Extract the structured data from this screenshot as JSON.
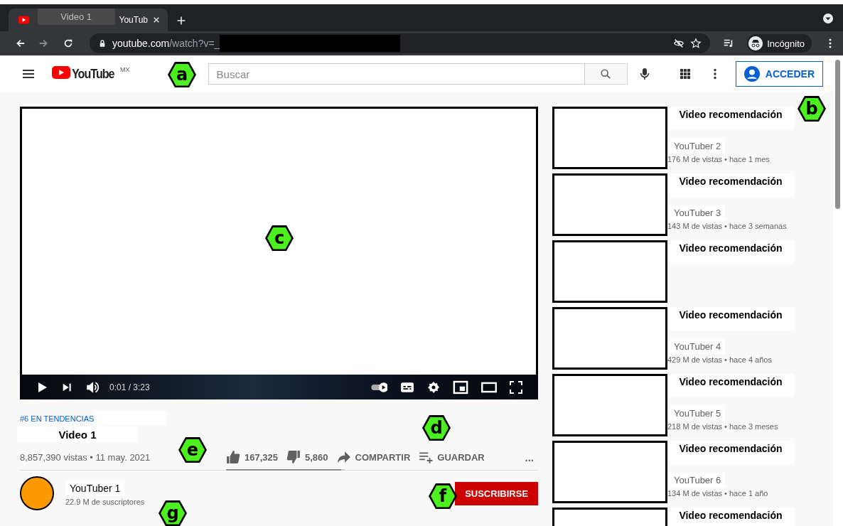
{
  "browser": {
    "tabs": [
      {
        "title_overlay": "Video 1",
        "title": "YouTub",
        "selected": true
      }
    ],
    "address": {
      "host": "youtube.com",
      "path": "/watch?v=_"
    },
    "profile": "Incógnito"
  },
  "header": {
    "logo": "YouTube",
    "region": "MX",
    "search": {
      "placeholder": "Buscar"
    },
    "sign_in": "ACCEDER"
  },
  "player": {
    "time": "0:01 / 3:23"
  },
  "video": {
    "trending": "#6 EN TENDENCIAS",
    "title": "Video 1",
    "stats": "8,857,390 vistas • 11 may. 2021",
    "likes": "167,325",
    "dislikes": "5,860",
    "like_ratio": {
      "level": 0.97
    },
    "share": "COMPARTIR",
    "save": "GUARDAR",
    "more": "...",
    "channel": {
      "name": "YouTuber 1",
      "subscribers": "22.9 M de suscriptores",
      "color": "#ff9900"
    },
    "subscribe": "SUSCRIBIRSE"
  },
  "recommendations": [
    {
      "title": "Video recomendación",
      "channel": "YouTuber 2",
      "meta": "176 M de vistas • hace 1 mes"
    },
    {
      "title": "Video recomendación",
      "channel": "YouTuber 3",
      "meta": "143 M de vistas • hace 3 semanas"
    },
    {
      "title": "Video recomendación"
    },
    {
      "title": "Video recomendación",
      "channel": "YouTuber 4",
      "meta": "429 M de vistas • hace 4 años"
    },
    {
      "title": "Video recomendación",
      "channel": "YouTuber 5",
      "meta": "218 M de vistas • hace 3 meses"
    },
    {
      "title": "Video recomendación",
      "channel": "YouTuber 6",
      "meta": "134 M de vistas • hace 1 año"
    },
    {
      "title": "Video recomendación"
    }
  ],
  "markers": [
    {
      "label": "a"
    },
    {
      "label": "b"
    },
    {
      "label": "c"
    },
    {
      "label": "d"
    },
    {
      "label": "e"
    },
    {
      "label": "f"
    },
    {
      "label": "g"
    }
  ]
}
